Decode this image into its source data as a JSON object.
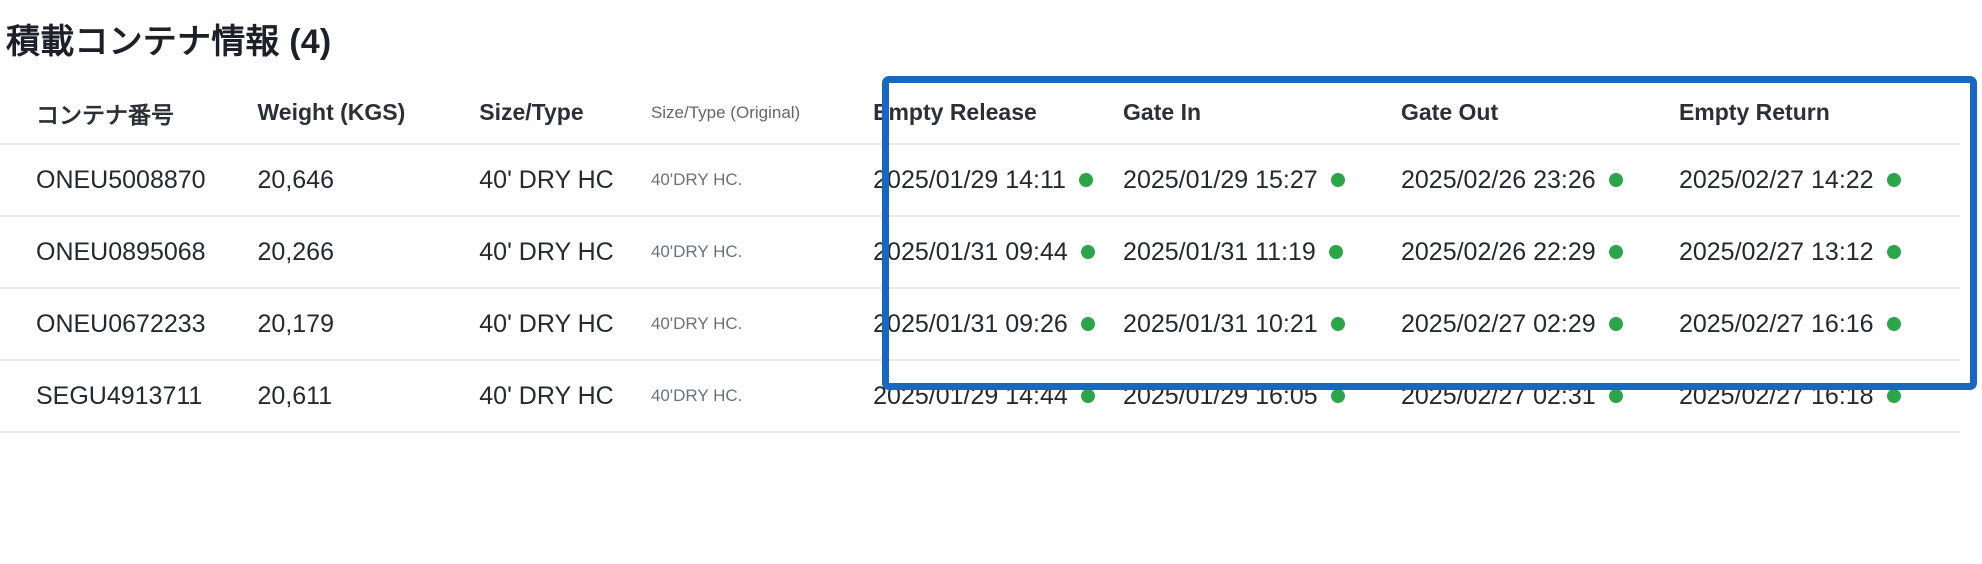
{
  "section": {
    "title": "積載コンテナ情報",
    "count": "(4)"
  },
  "table": {
    "headers": {
      "container_no": "コンテナ番号",
      "weight": "Weight (KGS)",
      "size_type": "Size/Type",
      "size_type_original": "Size/Type (Original)",
      "empty_release": "Empty Release",
      "gate_in": "Gate In",
      "gate_out": "Gate Out",
      "empty_return": "Empty Return"
    },
    "rows": [
      {
        "container_no": "ONEU5008870",
        "weight": "20,646",
        "size_type": "40' DRY HC",
        "size_type_original": "40'DRY HC.",
        "empty_release": "2025/01/29 14:11",
        "gate_in": "2025/01/29 15:27",
        "gate_out": "2025/02/26 23:26",
        "empty_return": "2025/02/27 14:22"
      },
      {
        "container_no": "ONEU0895068",
        "weight": "20,266",
        "size_type": "40' DRY HC",
        "size_type_original": "40'DRY HC.",
        "empty_release": "2025/01/31 09:44",
        "gate_in": "2025/01/31 11:19",
        "gate_out": "2025/02/26 22:29",
        "empty_return": "2025/02/27 13:12"
      },
      {
        "container_no": "ONEU0672233",
        "weight": "20,179",
        "size_type": "40' DRY HC",
        "size_type_original": "40'DRY HC.",
        "empty_release": "2025/01/31 09:26",
        "gate_in": "2025/01/31 10:21",
        "gate_out": "2025/02/27 02:29",
        "empty_return": "2025/02/27 16:16"
      },
      {
        "container_no": "SEGU4913711",
        "weight": "20,611",
        "size_type": "40' DRY HC",
        "size_type_original": "40'DRY HC.",
        "empty_release": "2025/01/29 14:44",
        "gate_in": "2025/01/29 16:05",
        "gate_out": "2025/02/27 02:31",
        "empty_return": "2025/02/27 16:18"
      }
    ]
  },
  "highlight": {
    "border_color": "#1868c0"
  },
  "status_dot": {
    "name": "status-dot-green",
    "color": "#2ea54b"
  }
}
